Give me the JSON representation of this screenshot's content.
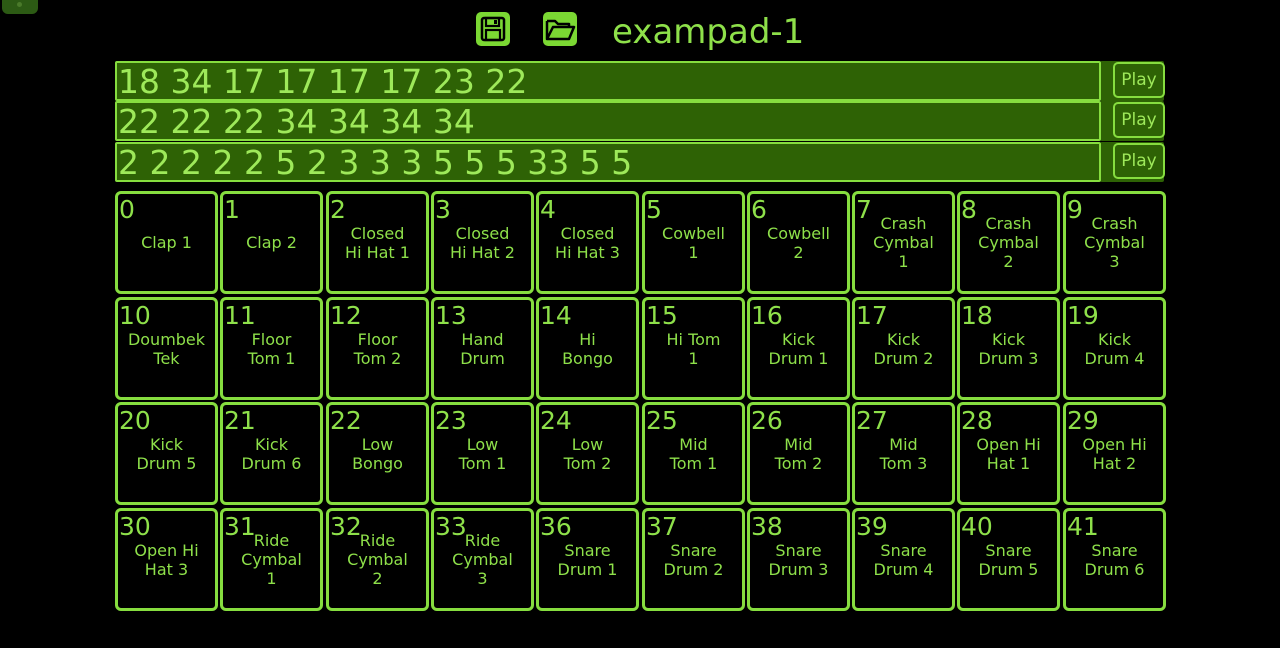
{
  "header": {
    "title": "exampad-1",
    "save_icon": "floppy-disk-icon",
    "open_icon": "folder-open-icon"
  },
  "colors": {
    "background": "#000000",
    "accent": "#86dd3f",
    "field_bg": "#2e6205",
    "text": "#8ee04a"
  },
  "sequences": [
    {
      "value": "18 34 17 17 17 17 23 22",
      "play_label": "Play"
    },
    {
      "value": "22 22 22 34 34 34 34",
      "play_label": "Play"
    },
    {
      "value": "2 2 2 2 2 5 2 3 3 3 5 5 5 33 5 5",
      "play_label": "Play"
    }
  ],
  "pads": [
    {
      "num": "0",
      "label": "Clap 1"
    },
    {
      "num": "1",
      "label": "Clap 2"
    },
    {
      "num": "2",
      "label": "Closed\nHi Hat 1"
    },
    {
      "num": "3",
      "label": "Closed\nHi Hat 2"
    },
    {
      "num": "4",
      "label": "Closed\nHi Hat 3"
    },
    {
      "num": "5",
      "label": "Cowbell\n1"
    },
    {
      "num": "6",
      "label": "Cowbell\n2"
    },
    {
      "num": "7",
      "label": "Crash\nCymbal\n1"
    },
    {
      "num": "8",
      "label": "Crash\nCymbal\n2"
    },
    {
      "num": "9",
      "label": "Crash\nCymbal\n3"
    },
    {
      "num": "10",
      "label": "Doumbek\nTek"
    },
    {
      "num": "11",
      "label": "Floor\nTom 1"
    },
    {
      "num": "12",
      "label": "Floor\nTom 2"
    },
    {
      "num": "13",
      "label": "Hand\nDrum"
    },
    {
      "num": "14",
      "label": "Hi\nBongo"
    },
    {
      "num": "15",
      "label": "Hi Tom\n1"
    },
    {
      "num": "16",
      "label": "Kick\nDrum 1"
    },
    {
      "num": "17",
      "label": "Kick\nDrum 2"
    },
    {
      "num": "18",
      "label": "Kick\nDrum 3"
    },
    {
      "num": "19",
      "label": "Kick\nDrum 4"
    },
    {
      "num": "20",
      "label": "Kick\nDrum 5"
    },
    {
      "num": "21",
      "label": "Kick\nDrum 6"
    },
    {
      "num": "22",
      "label": "Low\nBongo"
    },
    {
      "num": "23",
      "label": "Low\nTom 1"
    },
    {
      "num": "24",
      "label": "Low\nTom 2"
    },
    {
      "num": "25",
      "label": "Mid\nTom 1"
    },
    {
      "num": "26",
      "label": "Mid\nTom 2"
    },
    {
      "num": "27",
      "label": "Mid\nTom 3"
    },
    {
      "num": "28",
      "label": "Open Hi\nHat 1"
    },
    {
      "num": "29",
      "label": "Open Hi\nHat 2"
    },
    {
      "num": "30",
      "label": "Open Hi\nHat 3"
    },
    {
      "num": "31",
      "label": "Ride\nCymbal\n1"
    },
    {
      "num": "32",
      "label": "Ride\nCymbal\n2"
    },
    {
      "num": "33",
      "label": "Ride\nCymbal\n3"
    },
    {
      "num": "36",
      "label": "Snare\nDrum 1"
    },
    {
      "num": "37",
      "label": "Snare\nDrum 2"
    },
    {
      "num": "38",
      "label": "Snare\nDrum 3"
    },
    {
      "num": "39",
      "label": "Snare\nDrum 4"
    },
    {
      "num": "40",
      "label": "Snare\nDrum 5"
    },
    {
      "num": "41",
      "label": "Snare\nDrum 6"
    }
  ]
}
